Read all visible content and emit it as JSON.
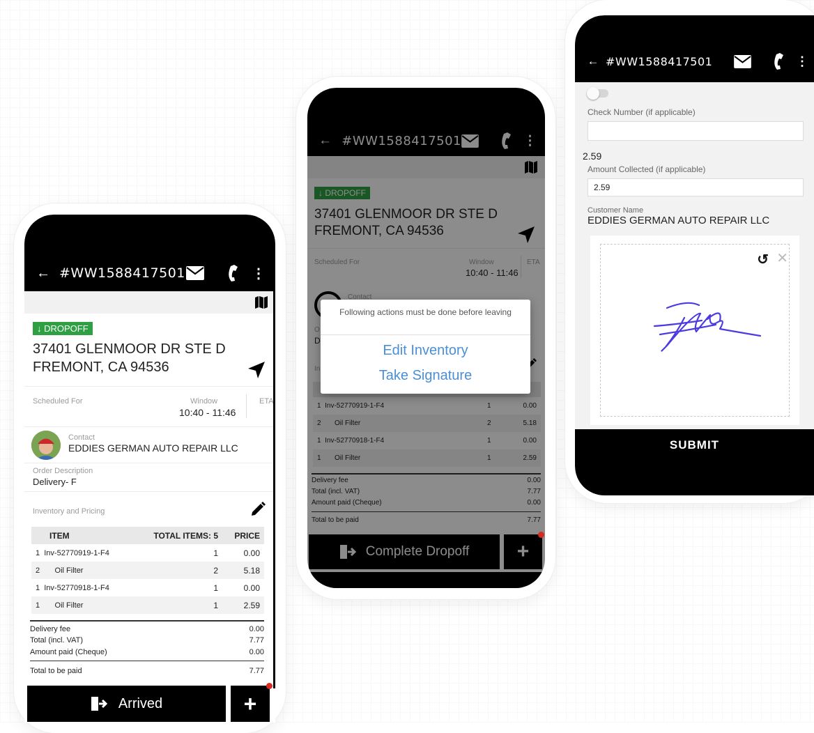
{
  "order_id": "#WW1588417501",
  "dropoff_badge": "↓ DROPOFF",
  "address_line1": "37401 GLENMOOR DR STE D",
  "address_line2": "FREMONT, CA 94536",
  "scheduled_label": "Scheduled For",
  "window_label": "Window",
  "window_value": "10:40 - 11:46",
  "eta_label": "ETA",
  "contact_label": "Contact",
  "contact_name": "EDDIES GERMAN AUTO REPAIR LLC",
  "order_desc_label": "Order Description",
  "order_desc_value": "Delivery- F",
  "inventory_label": "Inventory and Pricing",
  "table": {
    "col_item": "ITEM",
    "col_total": "TOTAL ITEMS: 5",
    "col_price": "PRICE",
    "rows": [
      {
        "n": "1",
        "item": "Inv-52770919-1-F4",
        "qty": "1",
        "price": "0.00"
      },
      {
        "n": "2",
        "item": "Oil Filter",
        "qty": "2",
        "price": "5.18"
      },
      {
        "n": "1",
        "item": "Inv-52770918-1-F4",
        "qty": "1",
        "price": "0.00"
      },
      {
        "n": "1",
        "item": "Oil Filter",
        "qty": "1",
        "price": "2.59"
      }
    ]
  },
  "totals": {
    "delivery_fee_label": "Delivery fee",
    "delivery_fee": "0.00",
    "total_vat_label": "Total (incl. VAT)",
    "total_vat": "7.77",
    "amount_paid_label": "Amount paid (Cheque)",
    "amount_paid": "0.00",
    "to_be_paid_label": "Total to be paid",
    "to_be_paid": "7.77"
  },
  "arrived_label": "Arrived",
  "complete_dropoff_label": "Complete Dropoff",
  "plus_label": "+",
  "dialog": {
    "message": "Following actions must be done before leaving",
    "action1": "Edit Inventory",
    "action2": "Take Signature"
  },
  "payment": {
    "check_label": "Check Number (if applicable)",
    "check_value": "",
    "amount_heading": "2.59",
    "amount_label": "Amount Collected (if applicable)",
    "amount_value": "2.59",
    "customer_label": "Customer Name",
    "customer_value": "EDDIES GERMAN AUTO REPAIR LLC",
    "submit_label": "SUBMIT"
  },
  "icons": {
    "back": "arrow-left-icon",
    "mail": "envelope-icon",
    "phone": "phone-icon",
    "more": "more-vertical-icon",
    "map": "map-icon",
    "navigate": "navigation-arrow-icon",
    "edit": "pencil-icon",
    "exit": "door-exit-icon",
    "undo": "undo-icon",
    "clear": "close-icon"
  },
  "colors": {
    "badge": "#2ea043",
    "link": "#4a8fd6",
    "notification": "#d62b1f",
    "signature": "#4b3be0"
  }
}
